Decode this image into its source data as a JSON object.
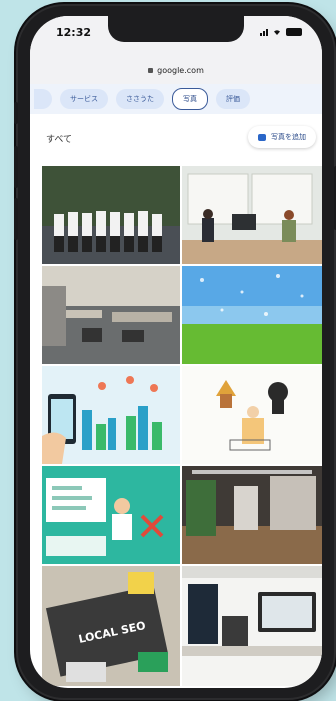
{
  "status": {
    "time": "12:32"
  },
  "browser": {
    "url": "google.com"
  },
  "tabs": [
    {
      "label": ""
    },
    {
      "label": "サービス"
    },
    {
      "label": "ささうた"
    },
    {
      "label": "写真"
    },
    {
      "label": "評価"
    }
  ],
  "section": {
    "title": "すべて",
    "add_photo_label": "写真を追加"
  },
  "photos": {
    "local_seo_sign_text": "LOCAL SEO"
  },
  "colors": {
    "background": "#bfe4e8",
    "accent": "#3a5a99",
    "camera_icon": "#2a66c8"
  }
}
